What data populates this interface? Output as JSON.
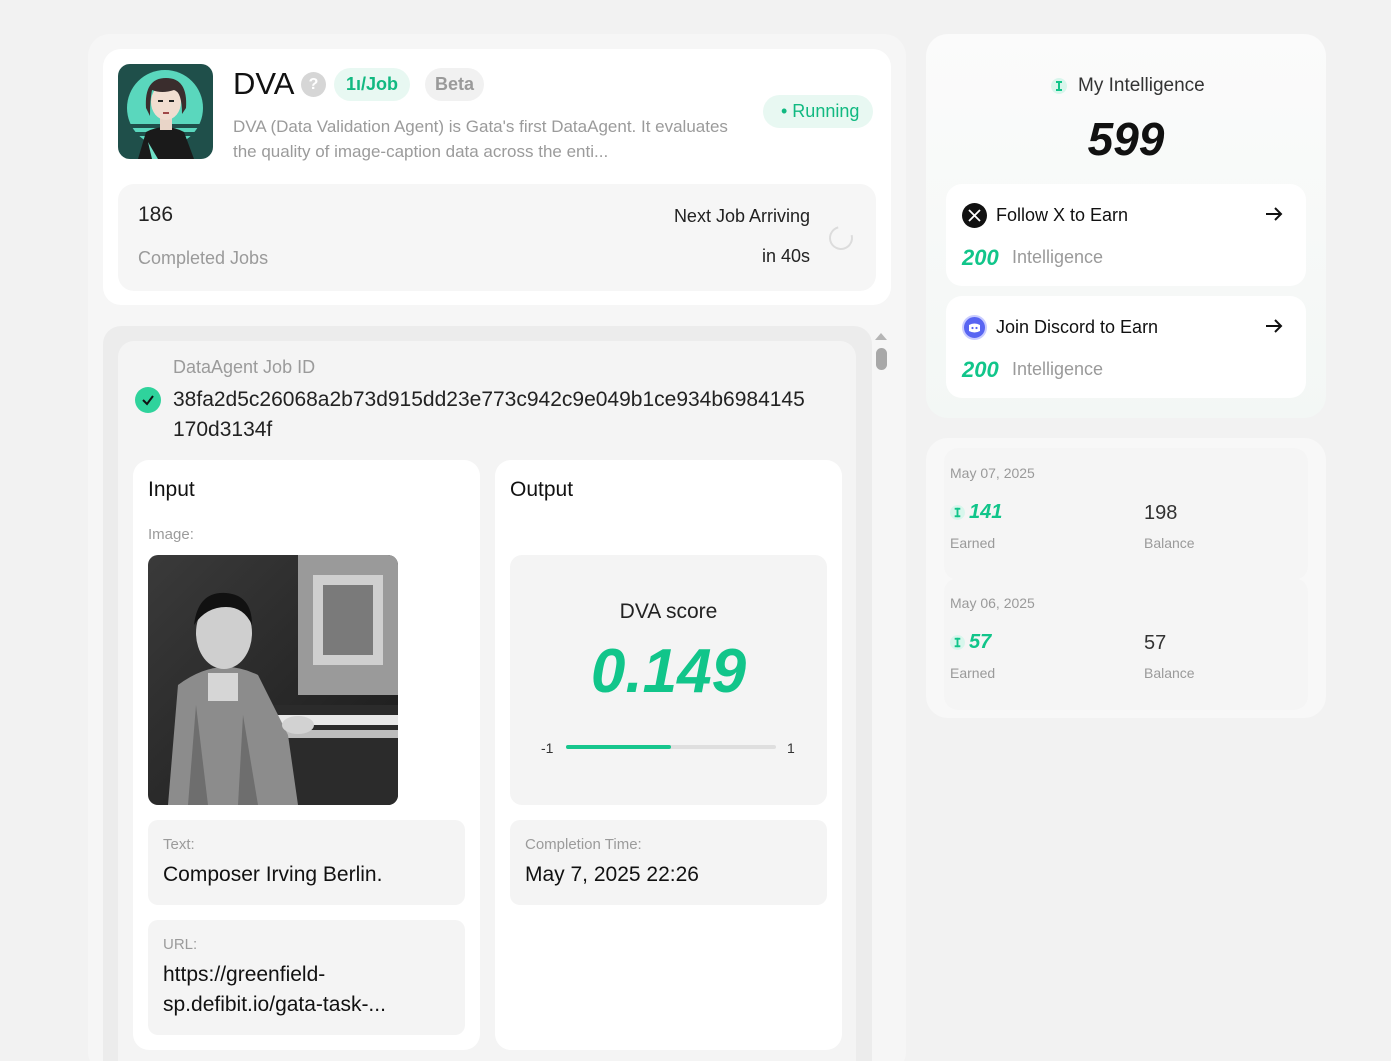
{
  "agent": {
    "name": "DVA",
    "help_glyph": "?",
    "price_badge": "1ı/Job",
    "beta_badge": "Beta",
    "status": "• Running",
    "description": "DVA (Data Validation Agent) is Gata's first DataAgent. It evaluates the quality of image-caption data across the enti...",
    "completed_jobs_count": "186",
    "completed_jobs_label": "Completed Jobs",
    "next_job_label": "Next Job Arriving",
    "next_job_time": "in 40s"
  },
  "job": {
    "id_label": "DataAgent Job ID",
    "id_value": "38fa2d5c26068a2b73d915dd23e773c942c9e049b1ce934b6984145170d3134f",
    "input": {
      "title": "Input",
      "image_label": "Image:",
      "text_label": "Text:",
      "text_value": "Composer Irving Berlin.",
      "url_label": "URL:",
      "url_value": "https://greenfield-sp.defibit.io/gata-task-..."
    },
    "output": {
      "title": "Output",
      "score_label": "DVA score",
      "score_value": "0.149",
      "range_min": "-1",
      "range_max": "1",
      "score_fraction": 0.5,
      "completion_label": "Completion Time:",
      "completion_value": "May 7, 2025 22:26"
    }
  },
  "intelligence": {
    "title": "My Intelligence",
    "value": "599",
    "tasks": [
      {
        "title": "Follow X to Earn",
        "amount": "200",
        "unit": "Intelligence",
        "icon": "x-logo-icon"
      },
      {
        "title": "Join Discord to Earn",
        "amount": "200",
        "unit": "Intelligence",
        "icon": "discord-icon"
      }
    ]
  },
  "history": [
    {
      "date": "May 07, 2025",
      "earned": "141",
      "earned_label": "Earned",
      "balance": "198",
      "balance_label": "Balance"
    },
    {
      "date": "May 06, 2025",
      "earned": "57",
      "earned_label": "Earned",
      "balance": "57",
      "balance_label": "Balance"
    }
  ],
  "colors": {
    "accent": "#11c58a",
    "badge_bg": "#e8f8f2",
    "muted": "#9b9b9b"
  }
}
